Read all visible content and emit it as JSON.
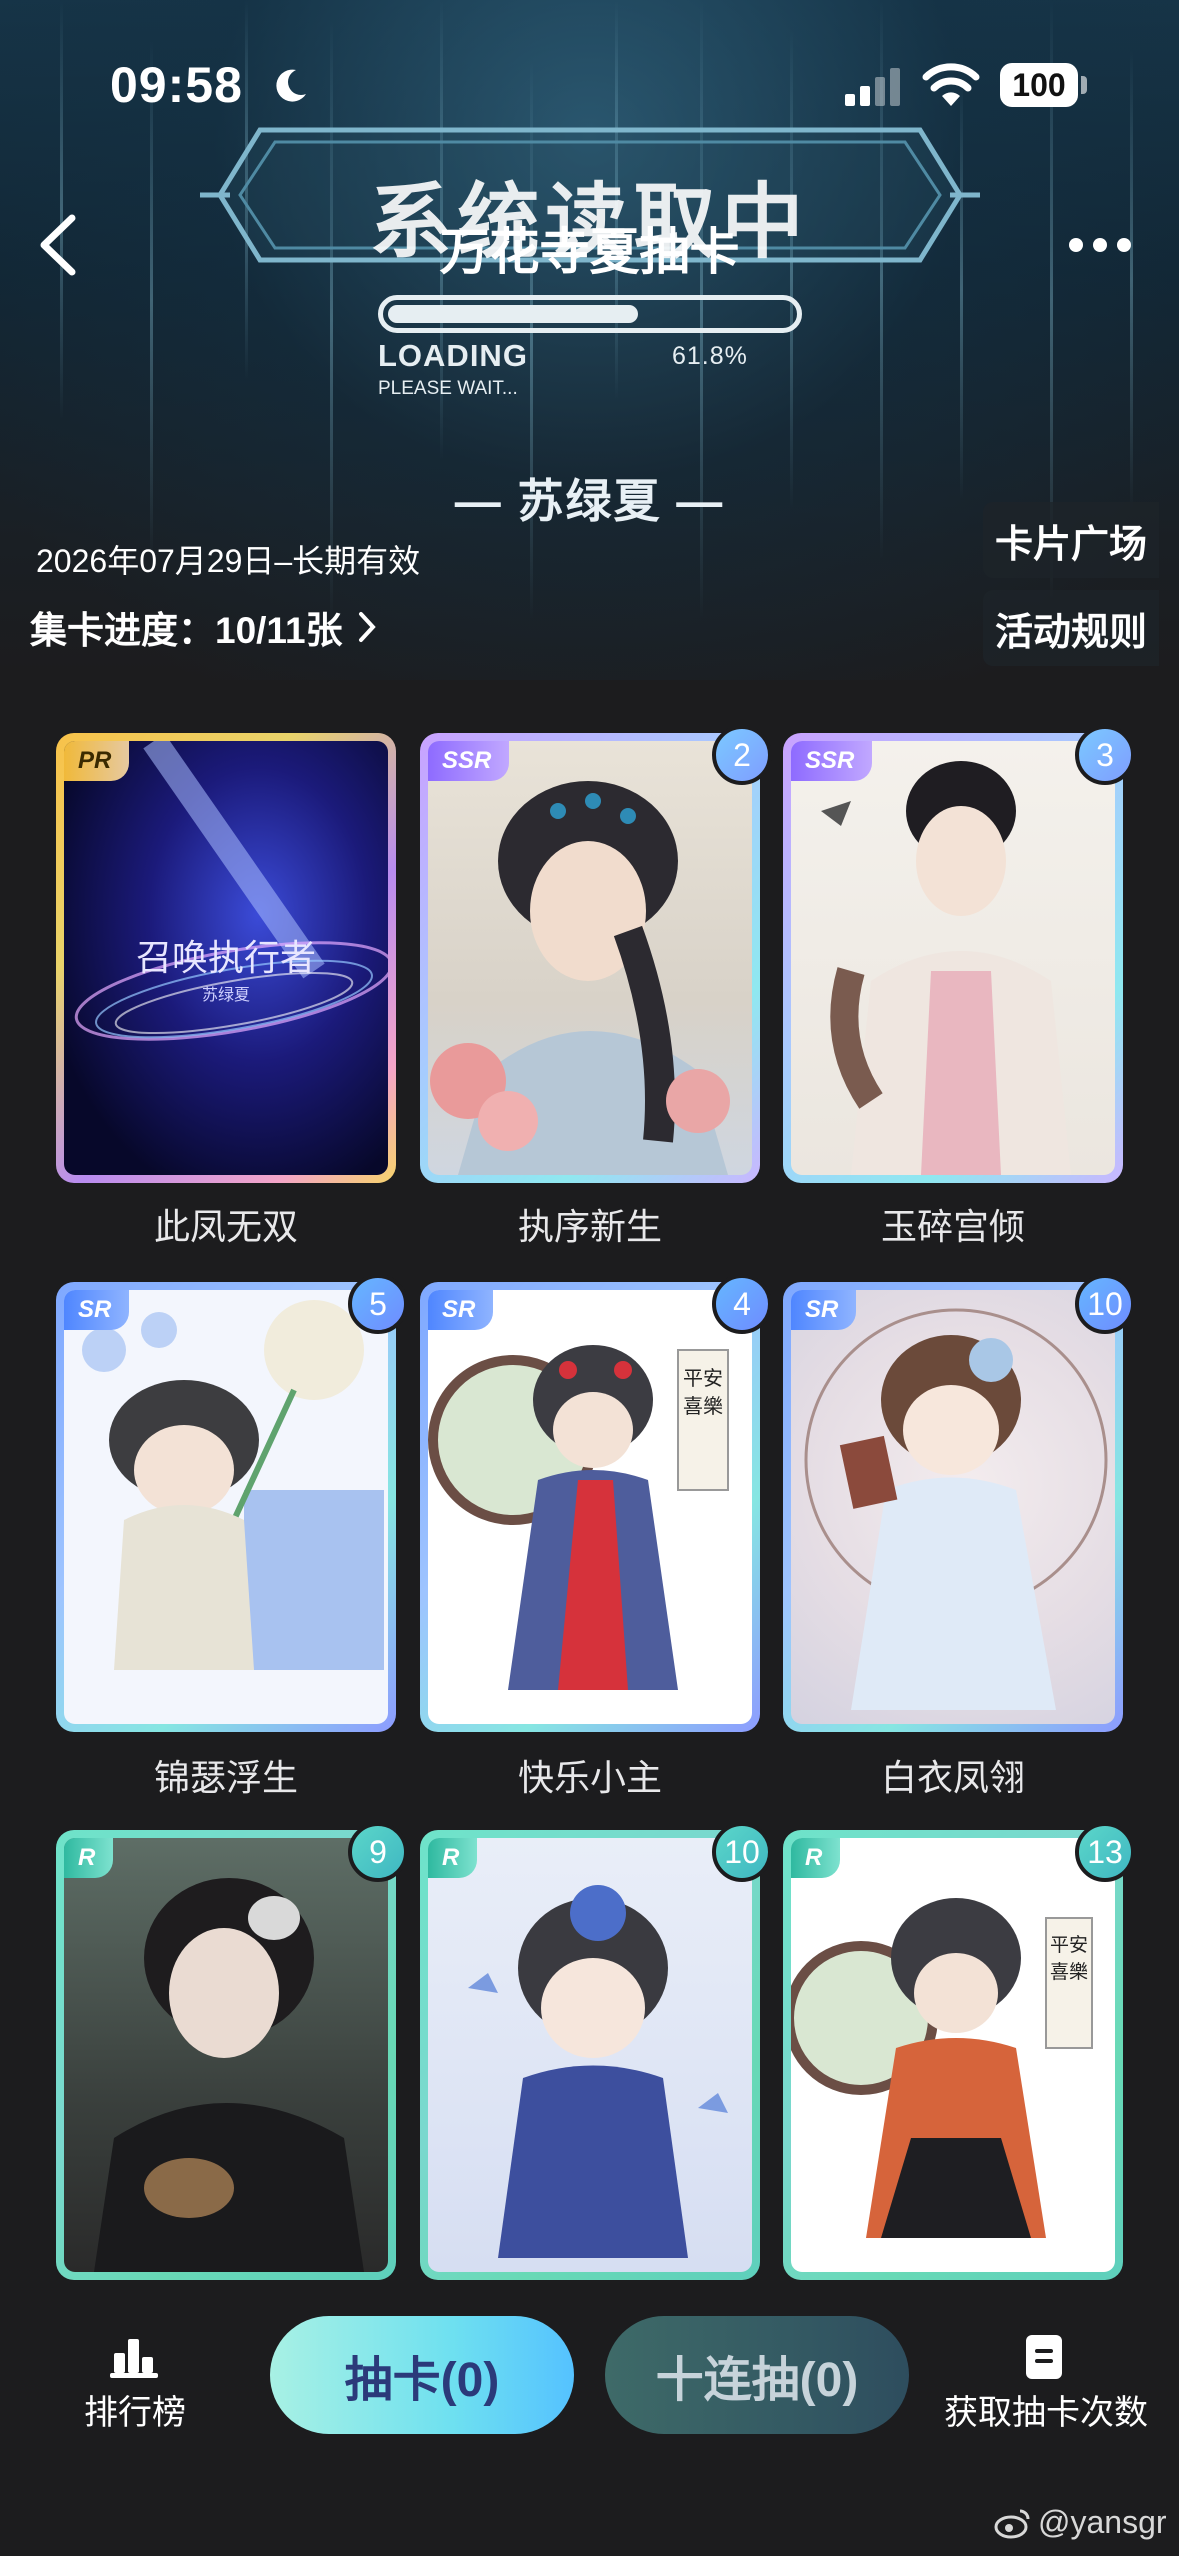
{
  "status_bar": {
    "time": "09:58",
    "battery": "100"
  },
  "banner": {
    "overlay_text": "系统读取中",
    "title": "万花寺夏抽卡",
    "loading_label": "LOADING",
    "loading_percent": "61.8%",
    "loading_progress": 0.618,
    "please_wait": "PLEASE WAIT..."
  },
  "collector_name": "— 苏绿夏 —",
  "validity": "2026年07月29日–长期有效",
  "collect_progress": "集卡进度：10/11张",
  "side_links": {
    "card_square": "卡片广场",
    "event_rules": "活动规则"
  },
  "cards": [
    {
      "rarity": "PR",
      "name": "此凤无双",
      "count": "",
      "inner_text": "召唤执行者",
      "inner_sub": "苏绿夏"
    },
    {
      "rarity": "SSR",
      "name": "执序新生",
      "count": "2"
    },
    {
      "rarity": "SSR",
      "name": "玉碎宫倾",
      "count": "3"
    },
    {
      "rarity": "SR",
      "name": "锦瑟浮生",
      "count": "5"
    },
    {
      "rarity": "SR",
      "name": "快乐小主",
      "count": "4",
      "scroll_text": "平安喜樂"
    },
    {
      "rarity": "SR",
      "name": "白衣凤翎",
      "count": "10"
    },
    {
      "rarity": "R",
      "name": "",
      "count": "9"
    },
    {
      "rarity": "R",
      "name": "",
      "count": "10"
    },
    {
      "rarity": "R",
      "name": "",
      "count": "13",
      "scroll_text": "平安喜樂"
    }
  ],
  "bottom_bar": {
    "leaderboard": "排行榜",
    "draw": "抽卡(0)",
    "ten_draw": "十连抽(0)",
    "get_draws": "获取抽卡次数"
  },
  "watermark": "@yansgr",
  "colors": {
    "accent": "#6ee0f0",
    "background": "#1c1c1e"
  }
}
